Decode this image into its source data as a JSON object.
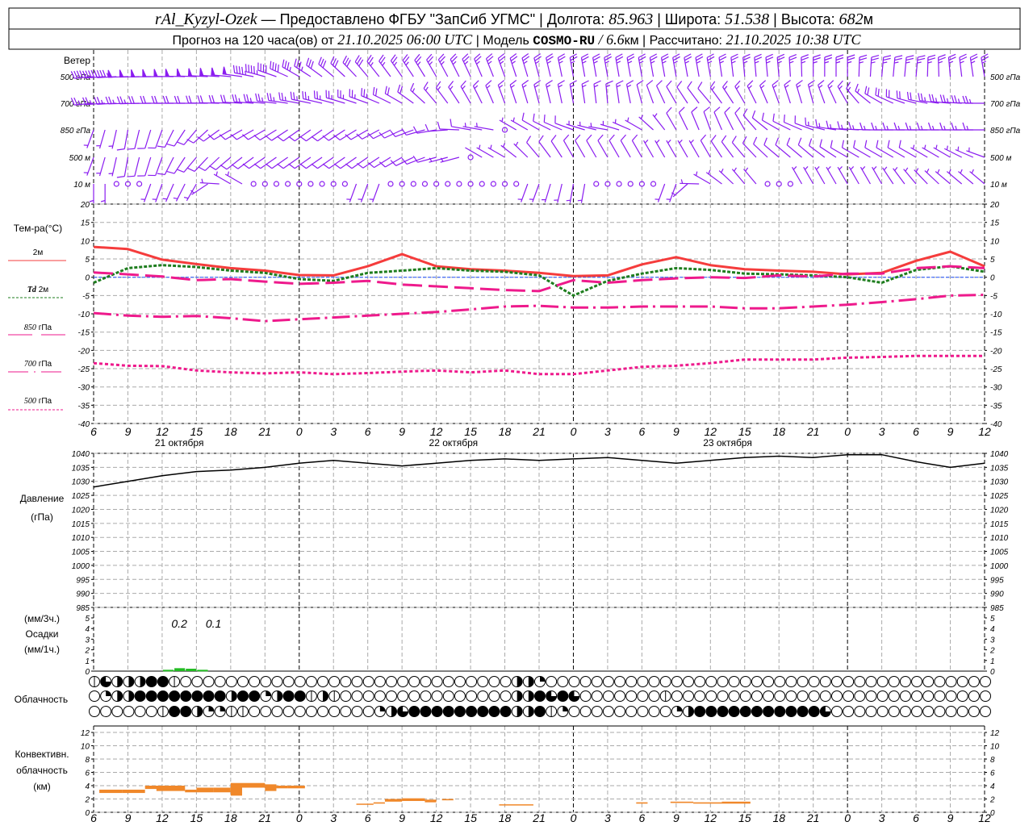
{
  "header": {
    "station": "rAl_Kyzyl-Ozek",
    "provider": " — Предоставлено ФГБУ \"ЗапСиб УГМС\" ",
    "sep": "|",
    "lon_label": " Долгота: ",
    "lon": "85.963",
    "lat_label": " Широта: ",
    "lat": "51.538",
    "alt_label": " Высота: ",
    "alt": "682",
    "alt_unit": "м",
    "forecast_label": "Прогноз на 120 часа(ов) от ",
    "init": "21.10.2025 06:00 UTC",
    "model_label": " Модель ",
    "model": "COSMO-RU",
    "res": " / 6.6",
    "res_unit": "км ",
    "calc_label": " Рассчитано: ",
    "calc": "21.10.2025 10:38 UTC"
  },
  "colors": {
    "wind": "#8a1cf0",
    "t2m": "#f53c3c",
    "td2m": "#1e7d1e",
    "t850": "#ee1a8c",
    "t700": "#ee1a8c",
    "t500": "#ee1a8c",
    "zero_line": "#2050ff",
    "precip": "#22bb22",
    "convective": "#f0882a"
  },
  "wind": {
    "title": "Ветер",
    "levels": [
      {
        "label": "500 гПа",
        "dir": [
          265,
          268,
          270,
          272,
          275,
          285,
          300,
          310,
          320,
          325,
          330,
          335,
          340,
          345,
          350,
          350,
          350,
          350,
          350,
          355,
          355,
          0,
          0,
          5,
          5,
          355,
          350
        ],
        "speed": [
          22,
          24,
          25,
          25,
          25,
          22,
          18,
          15,
          14,
          13,
          12,
          12,
          12,
          12,
          12,
          12,
          12,
          12,
          12,
          12,
          12,
          12,
          12,
          12,
          12,
          12,
          12
        ]
      },
      {
        "label": "700 гПа",
        "dir": [
          265,
          268,
          270,
          270,
          272,
          275,
          280,
          285,
          290,
          300,
          320,
          330,
          340,
          345,
          350,
          355,
          345,
          330,
          320,
          330,
          340,
          345,
          330,
          300,
          285,
          275,
          270
        ],
        "speed": [
          12,
          12,
          10,
          10,
          10,
          12,
          12,
          12,
          12,
          10,
          8,
          8,
          8,
          8,
          7,
          7,
          6,
          6,
          6,
          7,
          7,
          8,
          8,
          9,
          10,
          12,
          12
        ]
      },
      {
        "label": "850 гПа",
        "dir": [
          200,
          190,
          200,
          220,
          240,
          240,
          235,
          235,
          240,
          245,
          260,
          280,
          300,
          300,
          290,
          280,
          300,
          330,
          340,
          330,
          300,
          290,
          275,
          270,
          270,
          270,
          270
        ],
        "speed": [
          3,
          4,
          5,
          5,
          6,
          6,
          6,
          6,
          6,
          6,
          5,
          4,
          0,
          4,
          4,
          3,
          3,
          4,
          5,
          5,
          6,
          6,
          8,
          8,
          8,
          8,
          8
        ]
      },
      {
        "label": "500 м",
        "dir": [
          200,
          190,
          200,
          220,
          230,
          235,
          235,
          235,
          235,
          240,
          255,
          280,
          300,
          320,
          330,
          330,
          330,
          330,
          330,
          320,
          310,
          310,
          300,
          300,
          300,
          300,
          290
        ],
        "speed": [
          3,
          4,
          5,
          5,
          5,
          6,
          6,
          6,
          6,
          5,
          4,
          0,
          3,
          4,
          4,
          4,
          4,
          3,
          4,
          4,
          4,
          4,
          4,
          4,
          4,
          3,
          3
        ]
      },
      {
        "label": "10  м",
        "dir": [
          180,
          0,
          200,
          210,
          300,
          0,
          0,
          0,
          200,
          0,
          0,
          0,
          0,
          200,
          190,
          0,
          0,
          200,
          300,
          320,
          0,
          330,
          330,
          330,
          320,
          310,
          310
        ],
        "speed": [
          2,
          0,
          2,
          2,
          2,
          0,
          0,
          0,
          2,
          0,
          0,
          0,
          0,
          2,
          2,
          0,
          0,
          2,
          2,
          2,
          0,
          2,
          2,
          2,
          2,
          2,
          2
        ]
      }
    ]
  },
  "temperature": {
    "title": "Тем-ра(°C)",
    "legend": {
      "t2m": "2м",
      "td_prefix": "Td",
      "td_suffix": "2м",
      "t850_num": "850",
      "t700_num": "700",
      "t500_num": "500",
      "unit": "гПа"
    }
  },
  "pressure": {
    "title": "Давление",
    "unit": "(гПа)"
  },
  "precip": {
    "unit3": "(мм/3ч.)",
    "title": "Осадки",
    "unit1": "(мм/1ч.)",
    "labels": [
      {
        "hour": 7.5,
        "text": "0.2"
      },
      {
        "hour": 10.5,
        "text": "0.1"
      }
    ]
  },
  "clouds": {
    "title": "Облачность"
  },
  "convective": {
    "title1": "Конвективн.",
    "title2": "облачность",
    "unit": "(км)"
  },
  "x_axis": {
    "hour_labels": [
      "6",
      "9",
      "12",
      "15",
      "18",
      "21",
      "0",
      "3",
      "6",
      "9",
      "12",
      "15",
      "18",
      "21",
      "0",
      "3",
      "6",
      "9",
      "12",
      "15",
      "18",
      "21",
      "0",
      "3",
      "6",
      "9",
      "12"
    ],
    "dates": [
      {
        "hour": 7.5,
        "text": "21 октября"
      },
      {
        "hour": 31.5,
        "text": "22 октября"
      },
      {
        "hour": 55.5,
        "text": "23 октября"
      }
    ]
  },
  "chart_data": [
    {
      "type": "line",
      "title": "Тем-ра(°C)",
      "x_hours_from_start_step": 3,
      "ylim": [
        -40,
        20
      ],
      "yticks": [
        "20",
        "15",
        "10",
        "5",
        "0",
        "-5",
        "-10",
        "-15",
        "-20",
        "-25",
        "-30",
        "-35",
        "-40"
      ],
      "series": [
        {
          "name": "2м",
          "values": [
            8.3,
            7.7,
            4.8,
            3.6,
            2.5,
            1.8,
            0.6,
            0.5,
            3.0,
            6.3,
            3.0,
            2.2,
            1.8,
            1.2,
            0.3,
            0.5,
            3.5,
            5.5,
            3.3,
            2.2,
            1.8,
            1.5,
            0.8,
            1.2,
            4.5,
            7.0,
            3.0
          ]
        },
        {
          "name": "Td 2м",
          "values": [
            -1.5,
            2.5,
            3.3,
            2.8,
            1.8,
            1.2,
            -0.5,
            -1.0,
            1.2,
            1.8,
            2.5,
            1.8,
            1.5,
            0.5,
            -5.0,
            -1.0,
            1.0,
            2.5,
            2.0,
            1.0,
            0.8,
            0.5,
            0.0,
            -1.5,
            2.0,
            3.0,
            1.5
          ]
        },
        {
          "name": "850 гПа",
          "values": [
            1.3,
            0.8,
            0.2,
            -0.8,
            -0.5,
            -1.2,
            -1.8,
            -1.5,
            -1.0,
            -2.0,
            -2.5,
            -3.0,
            -3.5,
            -3.8,
            -0.8,
            -1.5,
            -0.8,
            -0.3,
            0.0,
            -0.2,
            0.5,
            0.2,
            1.0,
            1.0,
            2.5,
            3.0,
            2.5
          ]
        },
        {
          "name": "700 гПа",
          "values": [
            -9.8,
            -10.5,
            -10.8,
            -10.6,
            -11.2,
            -12.0,
            -11.5,
            -11.0,
            -10.5,
            -10.0,
            -9.5,
            -8.8,
            -8.0,
            -7.8,
            -8.3,
            -8.3,
            -8.0,
            -8.0,
            -8.0,
            -8.5,
            -8.5,
            -8.0,
            -7.5,
            -6.8,
            -6.0,
            -5.0,
            -4.8
          ]
        },
        {
          "name": "500 гПа",
          "values": [
            -23.5,
            -24.2,
            -24.3,
            -25.5,
            -26.0,
            -26.3,
            -26.0,
            -26.5,
            -26.2,
            -25.8,
            -25.5,
            -26.0,
            -25.5,
            -26.5,
            -26.5,
            -25.5,
            -24.5,
            -24.2,
            -23.5,
            -22.5,
            -22.5,
            -22.5,
            -22.0,
            -21.8,
            -21.5,
            -21.5,
            -21.5
          ]
        }
      ]
    },
    {
      "type": "line",
      "title": "Давление (гПа)",
      "x_hours_from_start_step": 3,
      "ylim": [
        985,
        1040
      ],
      "yticks": [
        "1040",
        "1035",
        "1030",
        "1025",
        "1020",
        "1015",
        "1010",
        "1005",
        "1000",
        "995",
        "990",
        "985"
      ],
      "values": [
        1028,
        1030,
        1032,
        1033.5,
        1034,
        1035,
        1036.5,
        1037.5,
        1036.5,
        1035.5,
        1036.5,
        1037.5,
        1038,
        1037.5,
        1038,
        1038.5,
        1037.5,
        1036.5,
        1037.5,
        1038.5,
        1039,
        1038.5,
        1039.5,
        1039.5,
        1037,
        1035,
        1036.5
      ]
    },
    {
      "type": "bar",
      "title": "Осадки (мм/1ч.)",
      "ylim": [
        0,
        5
      ],
      "yticks": [
        "5",
        "4",
        "3",
        "2",
        "1",
        "0"
      ],
      "bars": [
        {
          "start": 6,
          "end": 7,
          "value": 0.05
        },
        {
          "start": 7,
          "end": 8,
          "value": 0.2
        },
        {
          "start": 8,
          "end": 9,
          "value": 0.15
        },
        {
          "start": 9,
          "end": 10,
          "value": 0.05
        }
      ]
    },
    {
      "type": "table",
      "title": "Облачность",
      "note": "cover codes per hour: 0 clear, 1 trace, 2 quarter, 4 half, 6 three-quarter, 8 overcast",
      "rows": [
        [
          1,
          6,
          4,
          4,
          4,
          8,
          8,
          1,
          0,
          0,
          0,
          0,
          0,
          0,
          0,
          0,
          0,
          0,
          0,
          0,
          0,
          0,
          0,
          0,
          0,
          0,
          0,
          0,
          0,
          0,
          0,
          0,
          0,
          0,
          0,
          0,
          0,
          4,
          4,
          2,
          0,
          0,
          0,
          0,
          0,
          0,
          0,
          0,
          0,
          0,
          0,
          0,
          0,
          0,
          0,
          0,
          0,
          0,
          0,
          0,
          0,
          0,
          0,
          0,
          0,
          0,
          0,
          0,
          0,
          0,
          0,
          0,
          0,
          0,
          0,
          0,
          0,
          0,
          0
        ],
        [
          0,
          2,
          4,
          4,
          8,
          8,
          8,
          8,
          8,
          8,
          8,
          8,
          4,
          8,
          8,
          2,
          4,
          8,
          8,
          1,
          4,
          1,
          0,
          0,
          0,
          0,
          0,
          0,
          0,
          0,
          0,
          0,
          0,
          0,
          0,
          0,
          0,
          4,
          4,
          8,
          6,
          8,
          6,
          0,
          0,
          0,
          0,
          0,
          0,
          0,
          1,
          0,
          0,
          0,
          0,
          0,
          0,
          0,
          0,
          0,
          0,
          0,
          0,
          0,
          0,
          0,
          0,
          0,
          0,
          0,
          0,
          0,
          0,
          0,
          0,
          0,
          0,
          0,
          0
        ],
        [
          0,
          0,
          0,
          0,
          0,
          0,
          1,
          8,
          8,
          4,
          2,
          2,
          1,
          1,
          0,
          0,
          0,
          0,
          0,
          0,
          0,
          0,
          0,
          0,
          0,
          2,
          4,
          6,
          8,
          8,
          8,
          8,
          8,
          8,
          8,
          8,
          8,
          4,
          4,
          8,
          1,
          2,
          0,
          0,
          0,
          0,
          0,
          0,
          0,
          0,
          0,
          2,
          4,
          8,
          8,
          8,
          8,
          8,
          8,
          8,
          8,
          8,
          8,
          8,
          6,
          0,
          0,
          0,
          0,
          0,
          0,
          0,
          0,
          0,
          0,
          0,
          0,
          0,
          0
        ]
      ]
    },
    {
      "type": "bar",
      "title": "Конвективн. облачность (км)",
      "ylim": [
        0,
        13
      ],
      "yticks": [
        "12",
        "10",
        "8",
        "6",
        "4",
        "2",
        "0"
      ],
      "bars": [
        {
          "start": 0.5,
          "end": 2.5,
          "base": 2.9,
          "top": 3.4
        },
        {
          "start": 2.5,
          "end": 4.5,
          "base": 2.9,
          "top": 3.4
        },
        {
          "start": 4.5,
          "end": 8.0,
          "base": 3.5,
          "top": 4.0
        },
        {
          "start": 5.5,
          "end": 8.0,
          "base": 3.2,
          "top": 3.6
        },
        {
          "start": 8.0,
          "end": 9.0,
          "base": 3.0,
          "top": 3.4
        },
        {
          "start": 9.0,
          "end": 10.5,
          "base": 3.0,
          "top": 3.7
        },
        {
          "start": 10.5,
          "end": 12.0,
          "base": 3.0,
          "top": 3.7
        },
        {
          "start": 12.0,
          "end": 13.0,
          "base": 2.5,
          "top": 4.4
        },
        {
          "start": 13.0,
          "end": 15.0,
          "base": 3.7,
          "top": 4.4
        },
        {
          "start": 15.0,
          "end": 16.0,
          "base": 3.2,
          "top": 4.2
        },
        {
          "start": 16.0,
          "end": 17.0,
          "base": 3.6,
          "top": 4.0
        },
        {
          "start": 17.0,
          "end": 18.5,
          "base": 3.6,
          "top": 4.0
        },
        {
          "start": 23.0,
          "end": 24.5,
          "base": 1.2,
          "top": 1.3
        },
        {
          "start": 24.5,
          "end": 25.5,
          "base": 1.3,
          "top": 1.5
        },
        {
          "start": 25.5,
          "end": 27.0,
          "base": 1.6,
          "top": 2.0
        },
        {
          "start": 27.0,
          "end": 29.0,
          "base": 1.7,
          "top": 2.1
        },
        {
          "start": 29.0,
          "end": 30.0,
          "base": 1.5,
          "top": 1.9
        },
        {
          "start": 30.5,
          "end": 31.5,
          "base": 1.8,
          "top": 2.0
        },
        {
          "start": 35.5,
          "end": 38.5,
          "base": 1.1,
          "top": 1.2
        },
        {
          "start": 47.5,
          "end": 48.5,
          "base": 1.3,
          "top": 1.5
        },
        {
          "start": 50.5,
          "end": 52.5,
          "base": 1.4,
          "top": 1.6
        },
        {
          "start": 52.5,
          "end": 55.0,
          "base": 1.3,
          "top": 1.5
        },
        {
          "start": 55.0,
          "end": 57.5,
          "base": 1.3,
          "top": 1.6
        }
      ]
    }
  ]
}
